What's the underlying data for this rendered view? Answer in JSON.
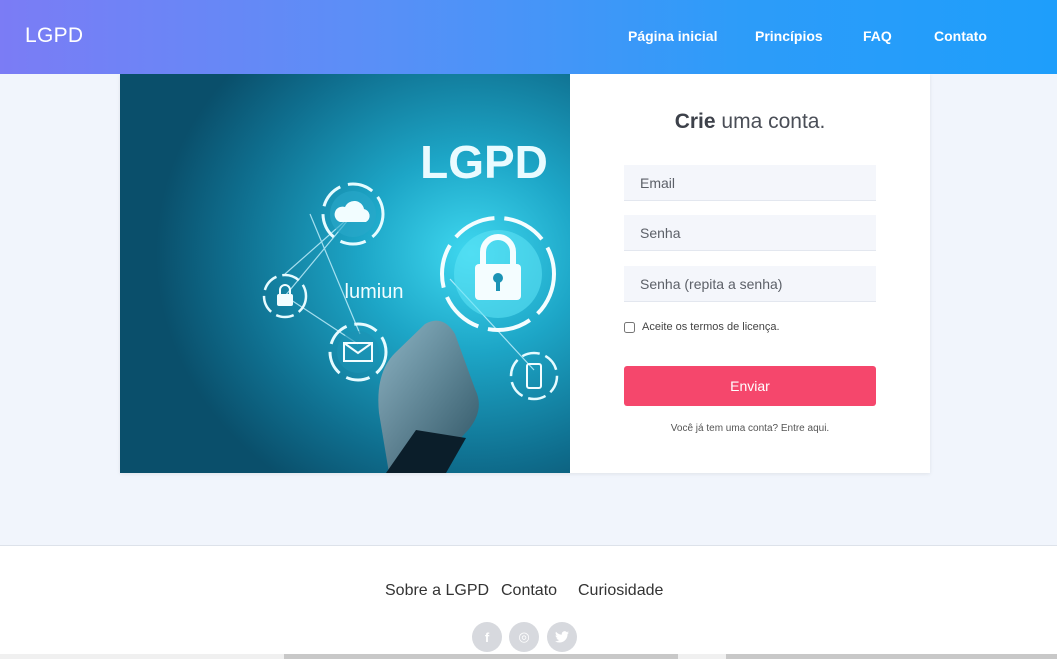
{
  "navbar": {
    "brand": "LGPD",
    "links": [
      "Página inicial",
      "Princípios",
      "FAQ",
      "Contato"
    ]
  },
  "hero": {
    "title": "LGPD",
    "logo": "lumiun",
    "icons": [
      "cloud-icon",
      "lock-icon",
      "padlock-small-icon",
      "envelope-icon",
      "phone-icon"
    ]
  },
  "form": {
    "title_bold": "Crie",
    "title_rest": " uma conta.",
    "email_placeholder": "Email",
    "password_placeholder": "Senha",
    "password_repeat_placeholder": "Senha (repita a senha)",
    "terms_label": "Aceite os termos de licença.",
    "terms_checked": false,
    "submit_label": "Enviar",
    "login_text": "Você já tem uma conta? Entre aqui."
  },
  "footer": {
    "links": [
      "Sobre a LGPD",
      "Contato",
      "Curiosidade"
    ],
    "social": [
      {
        "name": "facebook",
        "glyph": "f"
      },
      {
        "name": "instagram",
        "glyph": "◎"
      },
      {
        "name": "twitter",
        "glyph": "🐦"
      }
    ]
  },
  "colors": {
    "nav_gradient_start": "#7b7cf5",
    "nav_gradient_end": "#1e9efb",
    "submit_button": "#f5476c",
    "page_background": "#f1f5fc"
  }
}
